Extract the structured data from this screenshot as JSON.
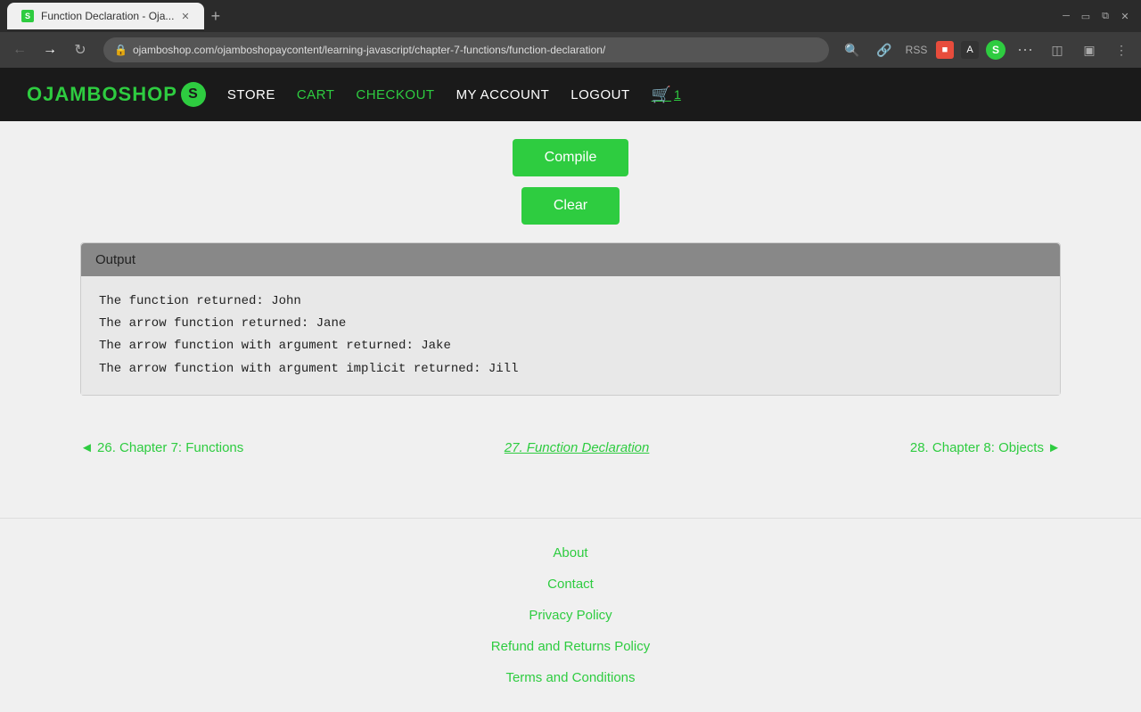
{
  "browser": {
    "tab_title": "Function Declaration - Oja...",
    "favicon_letter": "S",
    "url": "ojamboshop.com/ojamboshopaycontent/learning-javascript/chapter-7-functions/function-declaration/",
    "new_tab_label": "+"
  },
  "navbar": {
    "brand_name": "OJAMBOSHOP",
    "brand_letter": "S",
    "links": [
      {
        "label": "STORE",
        "href": "#"
      },
      {
        "label": "CART",
        "href": "#"
      },
      {
        "label": "CHECKOUT",
        "href": "#"
      },
      {
        "label": "MY ACCOUNT",
        "href": "#"
      },
      {
        "label": "LOGOUT",
        "href": "#"
      }
    ],
    "cart_count": "1"
  },
  "buttons": {
    "compile_label": "Compile",
    "clear_label": "Clear"
  },
  "output": {
    "header": "Output",
    "lines": [
      "The function returned: John",
      "The arrow function returned: Jane",
      "The arrow function with argument returned: Jake",
      "The arrow function with argument implicit returned: Jill"
    ]
  },
  "chapter_nav": {
    "prev_label": "◄ 26. Chapter 7: Functions",
    "current_label": "27. Function Declaration",
    "next_label": "28. Chapter 8: Objects ►"
  },
  "footer": {
    "links": [
      {
        "label": "About"
      },
      {
        "label": "Contact"
      },
      {
        "label": "Privacy Policy"
      },
      {
        "label": "Refund and Returns Policy"
      },
      {
        "label": "Terms and Conditions"
      }
    ]
  }
}
